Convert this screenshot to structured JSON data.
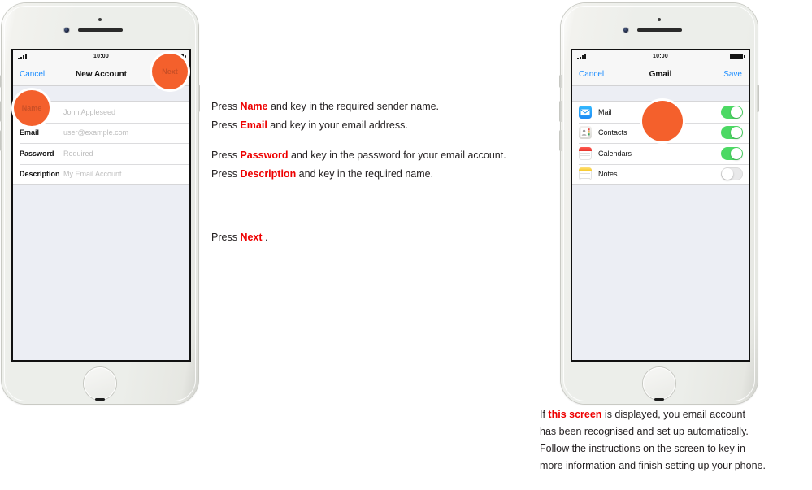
{
  "phone_left": {
    "name": "new-account-phone",
    "status": {
      "time": "10:00",
      "signal": "signal-bars-icon",
      "battery": "battery-icon"
    },
    "nav": {
      "left_label": "Cancel",
      "title": "New Account",
      "right_label": "Next"
    },
    "form_rows": [
      {
        "label": "Name",
        "placeholder": "John Appleseed"
      },
      {
        "label": "Email",
        "placeholder": "user@example.com"
      },
      {
        "label": "Password",
        "placeholder": "Required"
      },
      {
        "label": "Description",
        "placeholder": "My Email Account"
      }
    ],
    "annotations": [
      {
        "label": "Name",
        "target": "name-field"
      },
      {
        "label": "Next",
        "target": "next-button"
      }
    ]
  },
  "phone_right": {
    "name": "gmail-services-phone",
    "status": {
      "time": "10:00",
      "signal": "signal-bars-icon",
      "battery": "battery-icon"
    },
    "nav": {
      "left_label": "Cancel",
      "title": "Gmail",
      "right_label": "Save"
    },
    "service_rows": [
      {
        "label": "Mail",
        "icon": "mail-icon",
        "toggle": "on"
      },
      {
        "label": "Contacts",
        "icon": "contacts-icon",
        "toggle": "on"
      },
      {
        "label": "Calendars",
        "icon": "calendars-icon",
        "toggle": "on"
      },
      {
        "label": "Notes",
        "icon": "notes-icon",
        "toggle": "off"
      }
    ],
    "annotations": [
      {
        "label": "",
        "target": "services-list"
      }
    ]
  },
  "instructions": {
    "line1": {
      "pre": "Press ",
      "kw": "Name",
      "post": " and key in the required sender name."
    },
    "line2": {
      "pre": "Press ",
      "kw": "Email",
      "post": " and key in your email address."
    },
    "line3": {
      "pre": "Press ",
      "kw": "Password",
      "post": " and key in the password for your email account."
    },
    "line4": {
      "pre": "Press ",
      "kw": "Description",
      "post": " and key in the required name."
    },
    "press_next": {
      "pre": "Press ",
      "kw": "Next",
      "post": " ."
    }
  },
  "bottom_note": {
    "pre": "If ",
    "kw": "this screen",
    "post_line1": " is displayed, you email account",
    "line2": "has been recognised and set up automatically.",
    "line3": "Follow the instructions on the screen to key in",
    "line4": "more information and finish setting up your phone."
  },
  "colors": {
    "accent_orange": "#f4602c",
    "keyword_red": "#ee0000",
    "ios_blue": "#1a8cff",
    "toggle_green": "#4cd964"
  }
}
